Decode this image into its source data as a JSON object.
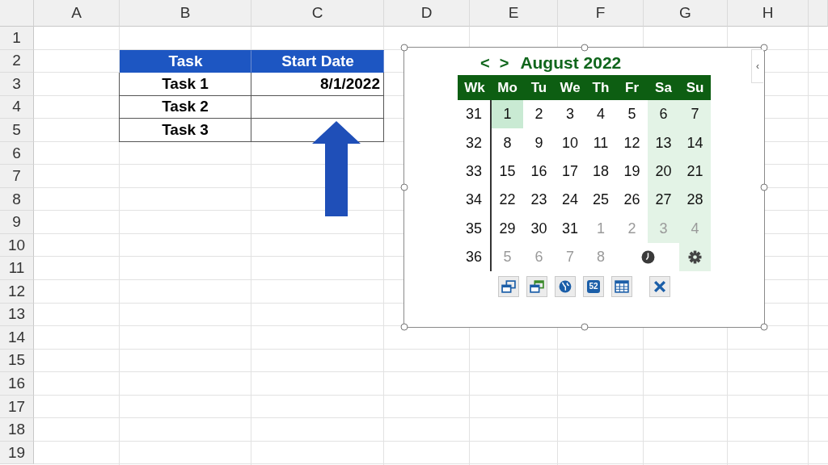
{
  "sheet": {
    "columns": [
      "A",
      "B",
      "C",
      "D",
      "E",
      "F",
      "G",
      "H"
    ],
    "rows": [
      "1",
      "2",
      "3",
      "4",
      "5",
      "6",
      "7",
      "8",
      "9",
      "10",
      "11",
      "12",
      "13",
      "14",
      "15",
      "16",
      "17",
      "18",
      "19"
    ]
  },
  "table": {
    "columns": [
      "Task",
      "Start Date"
    ],
    "rows": [
      {
        "task": "Task 1",
        "start_date": "8/1/2022"
      },
      {
        "task": "Task 2"
      },
      {
        "task": "Task 3"
      }
    ]
  },
  "calendar": {
    "prev": "<",
    "next": ">",
    "title": "August 2022",
    "collapse": "‹",
    "headers": [
      "Wk",
      "Mo",
      "Tu",
      "We",
      "Th",
      "Fr",
      "Sa",
      "Su"
    ],
    "weeks": [
      {
        "week": "31",
        "days": [
          {
            "kind": "day",
            "label": "1",
            "selected": true,
            "other_month": false,
            "shaded": false
          },
          {
            "kind": "day",
            "label": "2",
            "selected": false,
            "other_month": false,
            "shaded": false
          },
          {
            "kind": "day",
            "label": "3",
            "selected": false,
            "other_month": false,
            "shaded": false
          },
          {
            "kind": "day",
            "label": "4",
            "selected": false,
            "other_month": false,
            "shaded": false
          },
          {
            "kind": "day",
            "label": "5",
            "selected": false,
            "other_month": false,
            "shaded": false
          },
          {
            "kind": "day",
            "label": "6",
            "selected": false,
            "other_month": false,
            "shaded": true
          },
          {
            "kind": "day",
            "label": "7",
            "selected": false,
            "other_month": false,
            "shaded": true
          }
        ]
      },
      {
        "week": "32",
        "days": [
          {
            "kind": "day",
            "label": "8",
            "selected": false,
            "other_month": false,
            "shaded": false
          },
          {
            "kind": "day",
            "label": "9",
            "selected": false,
            "other_month": false,
            "shaded": false
          },
          {
            "kind": "day",
            "label": "10",
            "selected": false,
            "other_month": false,
            "shaded": false
          },
          {
            "kind": "day",
            "label": "11",
            "selected": false,
            "other_month": false,
            "shaded": false
          },
          {
            "kind": "day",
            "label": "12",
            "selected": false,
            "other_month": false,
            "shaded": false
          },
          {
            "kind": "day",
            "label": "13",
            "selected": false,
            "other_month": false,
            "shaded": true
          },
          {
            "kind": "day",
            "label": "14",
            "selected": false,
            "other_month": false,
            "shaded": true
          }
        ]
      },
      {
        "week": "33",
        "days": [
          {
            "kind": "day",
            "label": "15",
            "selected": false,
            "other_month": false,
            "shaded": false
          },
          {
            "kind": "day",
            "label": "16",
            "selected": false,
            "other_month": false,
            "shaded": false
          },
          {
            "kind": "day",
            "label": "17",
            "selected": false,
            "other_month": false,
            "shaded": false
          },
          {
            "kind": "day",
            "label": "18",
            "selected": false,
            "other_month": false,
            "shaded": false
          },
          {
            "kind": "day",
            "label": "19",
            "selected": false,
            "other_month": false,
            "shaded": false
          },
          {
            "kind": "day",
            "label": "20",
            "selected": false,
            "other_month": false,
            "shaded": true
          },
          {
            "kind": "day",
            "label": "21",
            "selected": false,
            "other_month": false,
            "shaded": true
          }
        ]
      },
      {
        "week": "34",
        "days": [
          {
            "kind": "day",
            "label": "22",
            "selected": false,
            "other_month": false,
            "shaded": false
          },
          {
            "kind": "day",
            "label": "23",
            "selected": false,
            "other_month": false,
            "shaded": false
          },
          {
            "kind": "day",
            "label": "24",
            "selected": false,
            "other_month": false,
            "shaded": false
          },
          {
            "kind": "day",
            "label": "25",
            "selected": false,
            "other_month": false,
            "shaded": false
          },
          {
            "kind": "day",
            "label": "26",
            "selected": false,
            "other_month": false,
            "shaded": false
          },
          {
            "kind": "day",
            "label": "27",
            "selected": false,
            "other_month": false,
            "shaded": true
          },
          {
            "kind": "day",
            "label": "28",
            "selected": false,
            "other_month": false,
            "shaded": true
          }
        ]
      },
      {
        "week": "35",
        "days": [
          {
            "kind": "day",
            "label": "29",
            "selected": false,
            "other_month": false,
            "shaded": false
          },
          {
            "kind": "day",
            "label": "30",
            "selected": false,
            "other_month": false,
            "shaded": false
          },
          {
            "kind": "day",
            "label": "31",
            "selected": false,
            "other_month": false,
            "shaded": false
          },
          {
            "kind": "day",
            "label": "1",
            "selected": false,
            "other_month": true,
            "shaded": false
          },
          {
            "kind": "day",
            "label": "2",
            "selected": false,
            "other_month": true,
            "shaded": false
          },
          {
            "kind": "day",
            "label": "3",
            "selected": false,
            "other_month": true,
            "shaded": true
          },
          {
            "kind": "day",
            "label": "4",
            "selected": false,
            "other_month": true,
            "shaded": true
          }
        ]
      },
      {
        "week": "36",
        "days": [
          {
            "kind": "day",
            "label": "5",
            "selected": false,
            "other_month": true,
            "shaded": false
          },
          {
            "kind": "day",
            "label": "6",
            "selected": false,
            "other_month": true,
            "shaded": false
          },
          {
            "kind": "day",
            "label": "7",
            "selected": false,
            "other_month": true,
            "shaded": false
          },
          {
            "kind": "day",
            "label": "8",
            "selected": false,
            "other_month": true,
            "shaded": false
          },
          {
            "kind": "clock",
            "shaded": false
          },
          {
            "kind": "gear",
            "shaded": true
          }
        ]
      }
    ],
    "toolbar": [
      {
        "kind": "window-back"
      },
      {
        "kind": "window-front"
      },
      {
        "kind": "globe"
      },
      {
        "kind": "week",
        "label": "52"
      },
      {
        "kind": "grid"
      },
      {
        "kind": "close"
      }
    ]
  }
}
